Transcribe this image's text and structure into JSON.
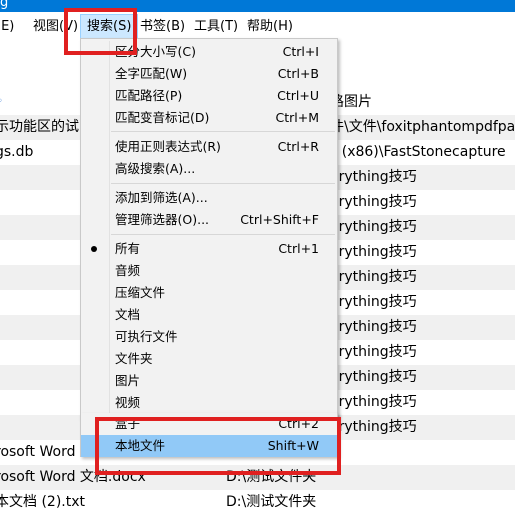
{
  "window": {
    "title_fragment": "g"
  },
  "menubar": {
    "items": [
      {
        "label": "(E)"
      },
      {
        "label": "视图(V)"
      },
      {
        "label": "搜索(S)"
      },
      {
        "label": "书签(B)"
      },
      {
        "label": "工具(T)"
      },
      {
        "label": "帮助(H)"
      }
    ]
  },
  "file_list": {
    "header_right": "路图片",
    "rows": [
      {
        "c1": "示功能区的试",
        "c2": "件\\文件\\foxitphantompdfpa",
        "c3": ""
      },
      {
        "c1": "gs.db",
        "c2": "s (x86)\\FastStonecapture",
        "c3": ""
      },
      {
        "c1": "",
        "c2": "erything技巧",
        "c3": ""
      },
      {
        "c1": "",
        "c2": "erything技巧",
        "c3": ""
      },
      {
        "c1": "",
        "c2": "erything技巧",
        "c3": ""
      },
      {
        "c1": "",
        "c2": "erything技巧",
        "c3": ""
      },
      {
        "c1": "",
        "c2": "erything技巧",
        "c3": ""
      },
      {
        "c1": "",
        "c2": "erything技巧",
        "c3": ""
      },
      {
        "c1": "",
        "c2": "erything技巧",
        "c3": ""
      },
      {
        "c1": "",
        "c2": "erything技巧",
        "c3": ""
      },
      {
        "c1": "",
        "c2": "erything技巧",
        "c3": ""
      },
      {
        "c1": "",
        "c2": "erything技巧",
        "c3": ""
      },
      {
        "c1": "",
        "c2": "erything技巧",
        "c3": ""
      },
      {
        "c1": "rosoft Word",
        "c2": "",
        "c3": ""
      },
      {
        "c1": "rosoft Word 文档.docx",
        "c2": "",
        "c3": "D:\\测试文件夹"
      },
      {
        "c1": "本文档 (2).txt",
        "c2": "",
        "c3": "D:\\测试文件夹"
      }
    ]
  },
  "search_menu": {
    "items": [
      {
        "label": "区分大小写(C)",
        "shortcut": "Ctrl+I"
      },
      {
        "label": "全字匹配(W)",
        "shortcut": "Ctrl+B"
      },
      {
        "label": "匹配路径(P)",
        "shortcut": "Ctrl+U"
      },
      {
        "label": "匹配变音标记(D)",
        "shortcut": "Ctrl+M"
      },
      {
        "label": "使用正则表达式(R)",
        "shortcut": "Ctrl+R"
      },
      {
        "label": "高级搜索(A)...",
        "shortcut": ""
      },
      {
        "label": "添加到筛选(A)...",
        "shortcut": ""
      },
      {
        "label": "管理筛选器(O)...",
        "shortcut": "Ctrl+Shift+F"
      },
      {
        "label": "所有",
        "shortcut": "Ctrl+1",
        "selected": true
      },
      {
        "label": "音频",
        "shortcut": ""
      },
      {
        "label": "压缩文件",
        "shortcut": ""
      },
      {
        "label": "文档",
        "shortcut": ""
      },
      {
        "label": "可执行文件",
        "shortcut": ""
      },
      {
        "label": "文件夹",
        "shortcut": ""
      },
      {
        "label": "图片",
        "shortcut": ""
      },
      {
        "label": "视频",
        "shortcut": ""
      },
      {
        "label": "盒子",
        "shortcut": "Ctrl+2"
      },
      {
        "label": "本地文件",
        "shortcut": "Shift+W",
        "highlighted": true
      }
    ]
  },
  "colors": {
    "titlebar": "#0078d7",
    "menu_bg": "#f2f2f2",
    "menu_highlight": "#91c9f7",
    "annotation_red": "#e02020",
    "row_alt": "#f0f0f0"
  }
}
